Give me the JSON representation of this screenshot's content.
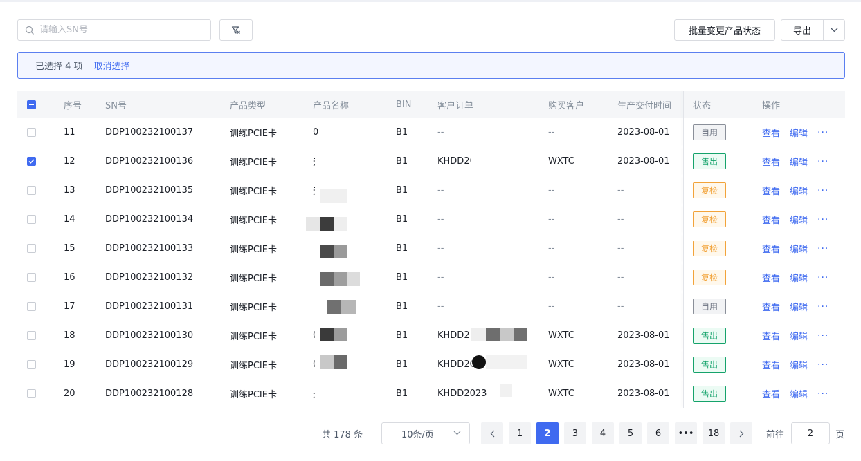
{
  "toolbar": {
    "search_placeholder": "请输入SN号",
    "batch_button": "批量变更产品状态",
    "export_button": "导出"
  },
  "selection": {
    "selected_text": "已选择 4 项",
    "cancel_text": "取消选择"
  },
  "table": {
    "headers": {
      "index": "序号",
      "sn": "SN号",
      "type": "产品类型",
      "name": "产品名称",
      "bin": "BIN",
      "order": "客户订单",
      "customer": "购买客户",
      "time": "生产交付时间",
      "status": "状态",
      "ops": "操作"
    },
    "op_view": "查看",
    "op_edit": "编辑",
    "op_more": "···",
    "rows": [
      {
        "checked": false,
        "index": "11",
        "sn": "DDP100232100137",
        "type": "训练PCIE卡",
        "name": "0",
        "bin": "B1",
        "order": "--",
        "customer": "--",
        "time": "2023-08-01",
        "status": "自用",
        "status_style": "gray"
      },
      {
        "checked": true,
        "index": "12",
        "sn": "DDP100232100136",
        "type": "训练PCIE卡",
        "name": "元",
        "bin": "B1",
        "order": "KHDD2023...0...",
        "customer": "WXTC",
        "time": "2023-08-01",
        "status": "售出",
        "status_style": "green"
      },
      {
        "checked": false,
        "index": "13",
        "sn": "DDP100232100135",
        "type": "训练PCIE卡",
        "name": "元",
        "bin": "B1",
        "order": "--",
        "customer": "--",
        "time": "--",
        "status": "复检",
        "status_style": "orange"
      },
      {
        "checked": false,
        "index": "14",
        "sn": "DDP100232100134",
        "type": "训练PCIE卡",
        "name": "",
        "bin": "B1",
        "order": "--",
        "customer": "--",
        "time": "--",
        "status": "复检",
        "status_style": "orange"
      },
      {
        "checked": false,
        "index": "15",
        "sn": "DDP100232100133",
        "type": "训练PCIE卡",
        "name": "",
        "bin": "B1",
        "order": "--",
        "customer": "--",
        "time": "--",
        "status": "复检",
        "status_style": "orange"
      },
      {
        "checked": false,
        "index": "16",
        "sn": "DDP100232100132",
        "type": "训练PCIE卡",
        "name": "",
        "bin": "B1",
        "order": "--",
        "customer": "--",
        "time": "--",
        "status": "复检",
        "status_style": "orange"
      },
      {
        "checked": false,
        "index": "17",
        "sn": "DDP100232100131",
        "type": "训练PCIE卡",
        "name": "",
        "bin": "B1",
        "order": "--",
        "customer": "--",
        "time": "--",
        "status": "自用",
        "status_style": "gray"
      },
      {
        "checked": false,
        "index": "18",
        "sn": "DDP100232100130",
        "type": "训练PCIE卡",
        "name": "0",
        "bin": "B1",
        "order": "KHDD2",
        "customer": "WXTC",
        "time": "2023-08-01",
        "status": "售出",
        "status_style": "green"
      },
      {
        "checked": false,
        "index": "19",
        "sn": "DDP100232100129",
        "type": "训练PCIE卡",
        "name": "0",
        "bin": "B1",
        "order": "KHDD2C",
        "customer": "WXTC",
        "time": "2023-08-01",
        "status": "售出",
        "status_style": "green"
      },
      {
        "checked": false,
        "index": "20",
        "sn": "DDP100232100128",
        "type": "训练PCIE卡",
        "name": "元",
        "bin": "B1",
        "order": "KHDD2023",
        "customer": "WXTC",
        "time": "2023-08-01",
        "status": "售出",
        "status_style": "green"
      }
    ]
  },
  "pagination": {
    "total_text": "共 178 条",
    "page_size": "10条/页",
    "pages": [
      "1",
      "2",
      "3",
      "4",
      "5",
      "6",
      "•••",
      "18"
    ],
    "current_page": "2",
    "goto_label": "前往",
    "goto_value": "2",
    "page_suffix": "页"
  }
}
